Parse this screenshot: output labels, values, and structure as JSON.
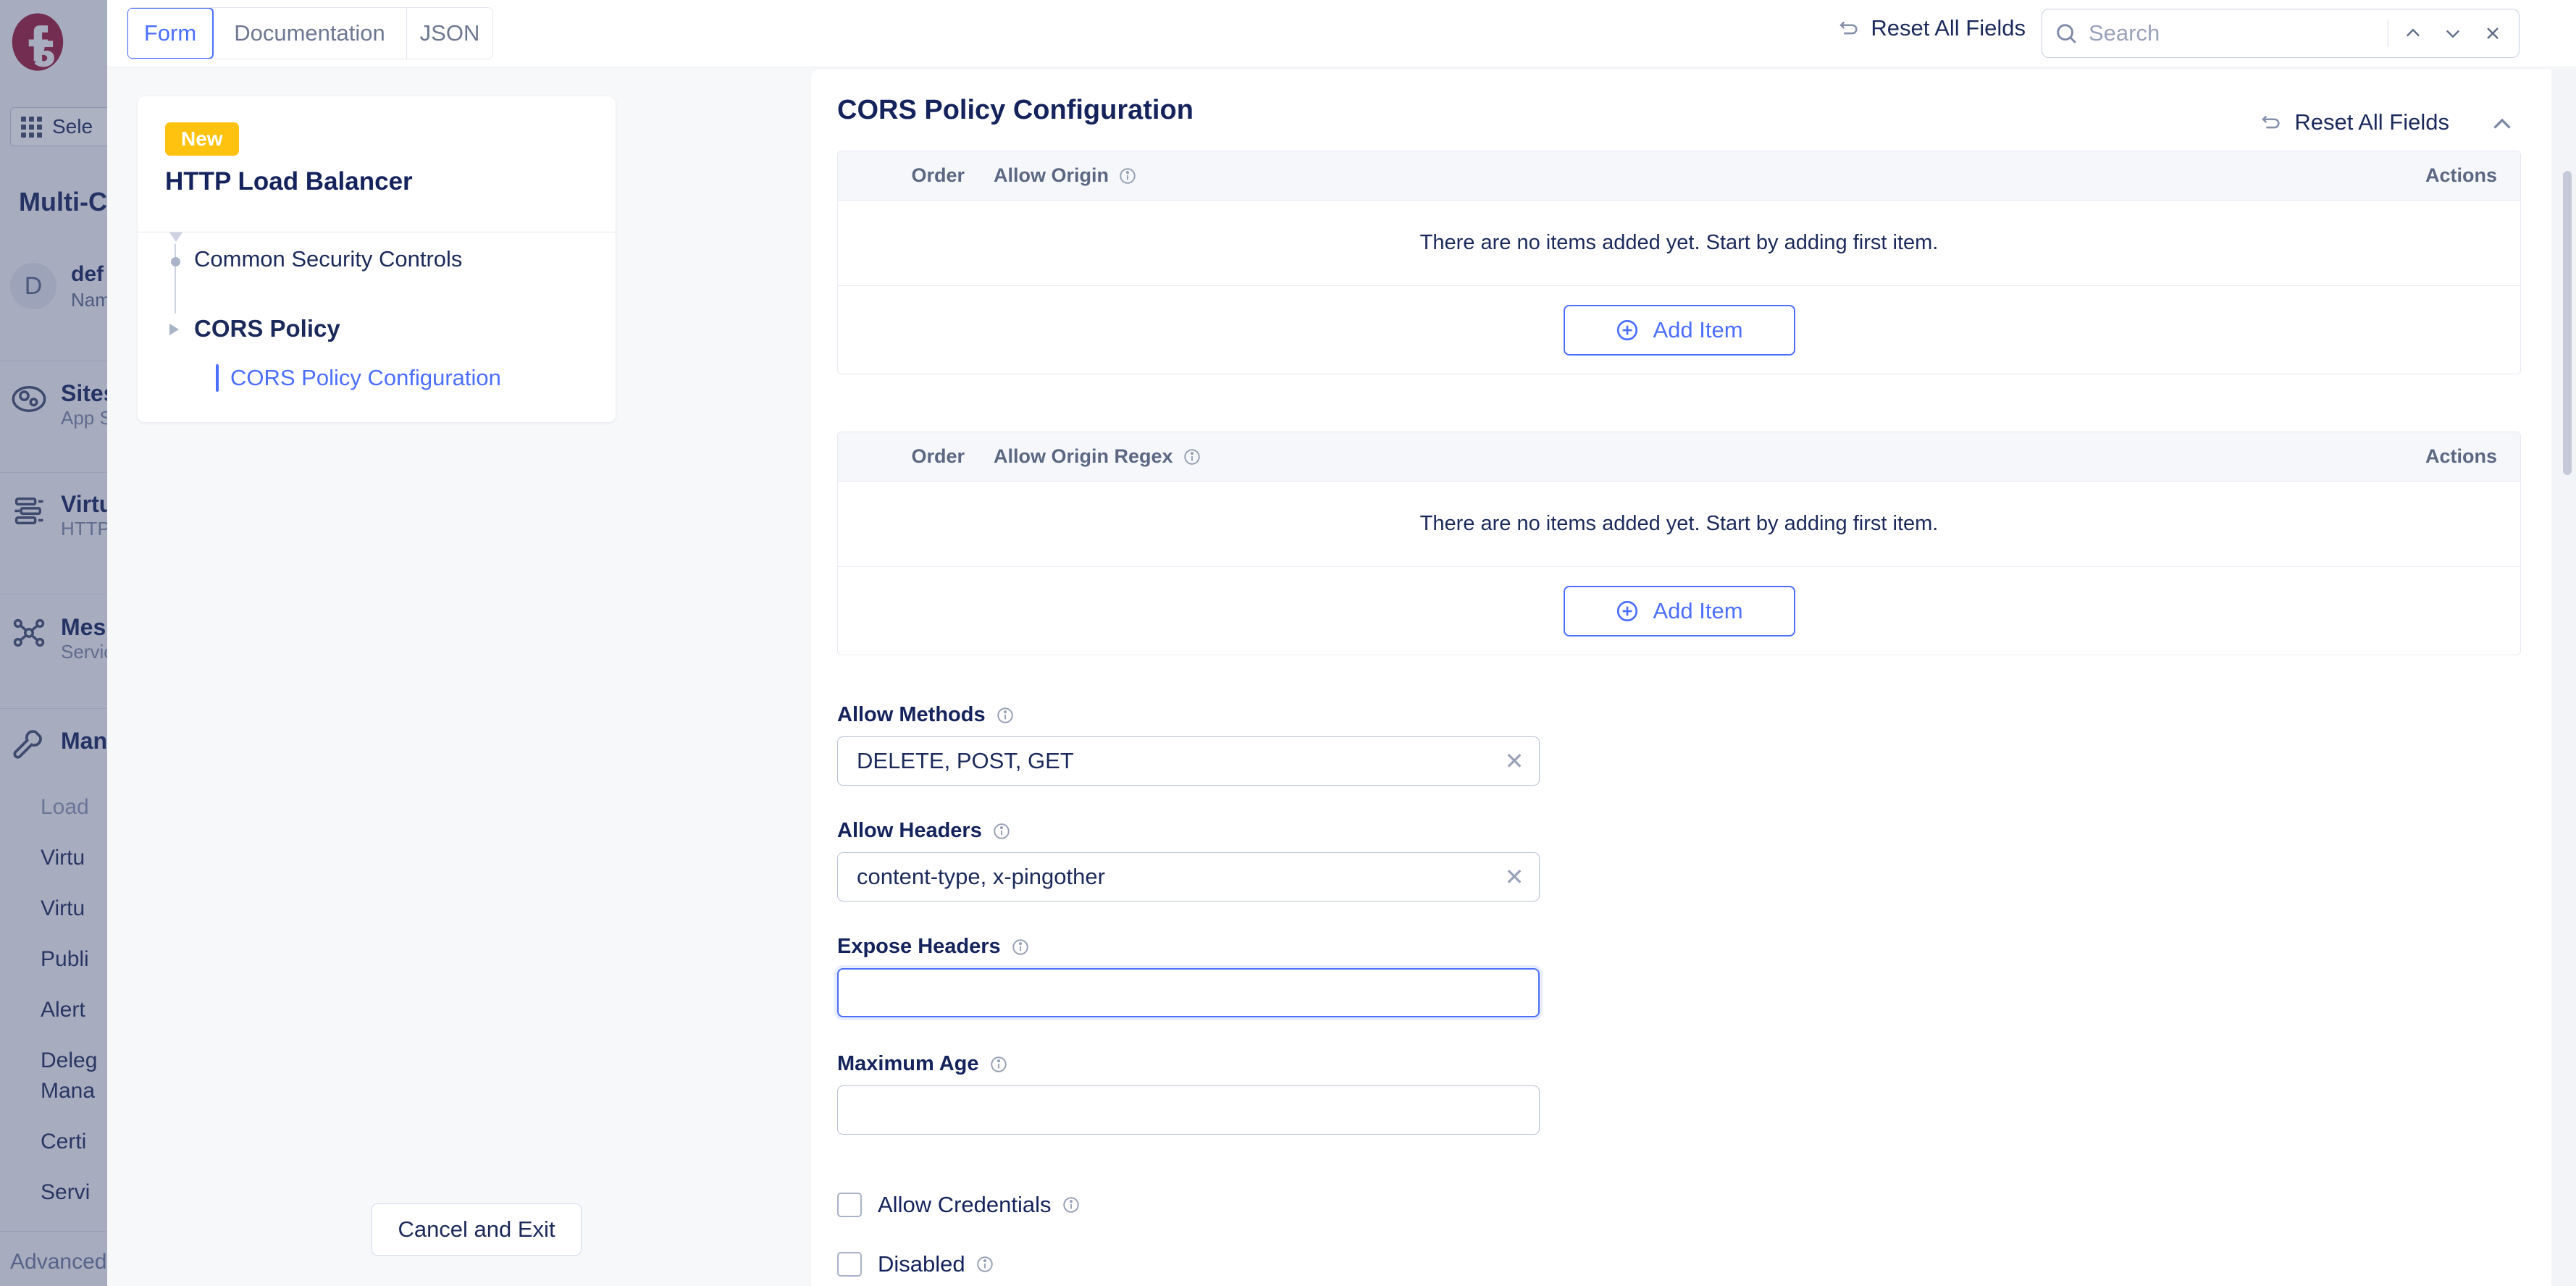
{
  "background_app": {
    "logo": "f5-logo",
    "namespace_selector": {
      "icon": "grid-icon",
      "label": "Sele"
    },
    "heading": "Multi-C",
    "tenant": {
      "avatar_initial": "D",
      "name": "def",
      "sub": "Nam"
    },
    "nav_items": [
      {
        "icon": "globe-icon",
        "title": "Sites",
        "sub": "App S"
      },
      {
        "icon": "virtual-sites-icon",
        "title": "Virtu",
        "sub": "HTTP"
      },
      {
        "icon": "mesh-icon",
        "title": "Mes",
        "sub": "Servic"
      },
      {
        "icon": "wrench-icon",
        "title": "Man",
        "sub": ""
      }
    ],
    "sub_items": [
      {
        "label": "Load",
        "muted": true
      },
      {
        "label": "Virtu",
        "muted": false
      },
      {
        "label": "Virtu",
        "muted": false
      },
      {
        "label": "Publi",
        "muted": false
      },
      {
        "label": "Alert",
        "muted": false
      },
      {
        "label": "Deleg",
        "muted": false
      },
      {
        "label": "Mana",
        "muted": false
      },
      {
        "label": "Certi",
        "muted": false
      },
      {
        "label": "Servi",
        "muted": false
      }
    ],
    "advanced_label": "Advanced"
  },
  "topbar": {
    "tabs": [
      {
        "id": "form",
        "label": "Form",
        "active": true
      },
      {
        "id": "documentation",
        "label": "Documentation",
        "active": false
      },
      {
        "id": "json",
        "label": "JSON",
        "active": false
      }
    ],
    "reset_all_label": "Reset All Fields",
    "reset_icon": "reset-arrow-icon",
    "search": {
      "icon": "search-icon",
      "placeholder": "Search",
      "value": "",
      "prev_icon": "chevron-up-icon",
      "next_icon": "chevron-down-icon",
      "close_icon": "close-icon"
    }
  },
  "wizard_nav": {
    "badge": "New",
    "object_title": "HTTP Load Balancer",
    "tree": [
      {
        "label": "Common Security Controls",
        "level": 1,
        "selected": false,
        "bold": false
      },
      {
        "label": "CORS Policy",
        "level": 1,
        "selected": false,
        "bold": true
      },
      {
        "label": "CORS Policy Configuration",
        "level": 2,
        "selected": true,
        "bold": false
      }
    ],
    "cancel_label": "Cancel and Exit"
  },
  "content": {
    "title": "CORS Policy Configuration",
    "reset_all_label": "Reset All Fields",
    "collapse_icon": "chevron-up-icon",
    "tables": [
      {
        "col_order": "Order",
        "col_main": "Allow Origin",
        "col_actions": "Actions",
        "empty_text": "There are no items added yet. Start by adding first item.",
        "add_label": "Add Item"
      },
      {
        "col_order": "Order",
        "col_main": "Allow Origin Regex",
        "col_actions": "Actions",
        "empty_text": "There are no items added yet. Start by adding first item.",
        "add_label": "Add Item"
      }
    ],
    "fields": [
      {
        "label": "Allow Methods",
        "value": "DELETE, POST, GET",
        "placeholder": "",
        "clearable": true,
        "focused": false
      },
      {
        "label": "Allow Headers",
        "value": "content-type, x-pingother",
        "placeholder": "",
        "clearable": true,
        "focused": false
      },
      {
        "label": "Expose Headers",
        "value": "",
        "placeholder": "",
        "clearable": false,
        "focused": true
      },
      {
        "label": "Maximum Age",
        "value": "",
        "placeholder": "",
        "clearable": false,
        "focused": false
      }
    ],
    "checkboxes": [
      {
        "label": "Allow Credentials",
        "checked": false
      },
      {
        "label": "Disabled",
        "checked": false
      }
    ]
  },
  "colors": {
    "accent_blue": "#4c6fff",
    "badge_yellow": "#ffc20e",
    "text_navy": "#15235c",
    "brand_red": "#9b1b3b"
  }
}
